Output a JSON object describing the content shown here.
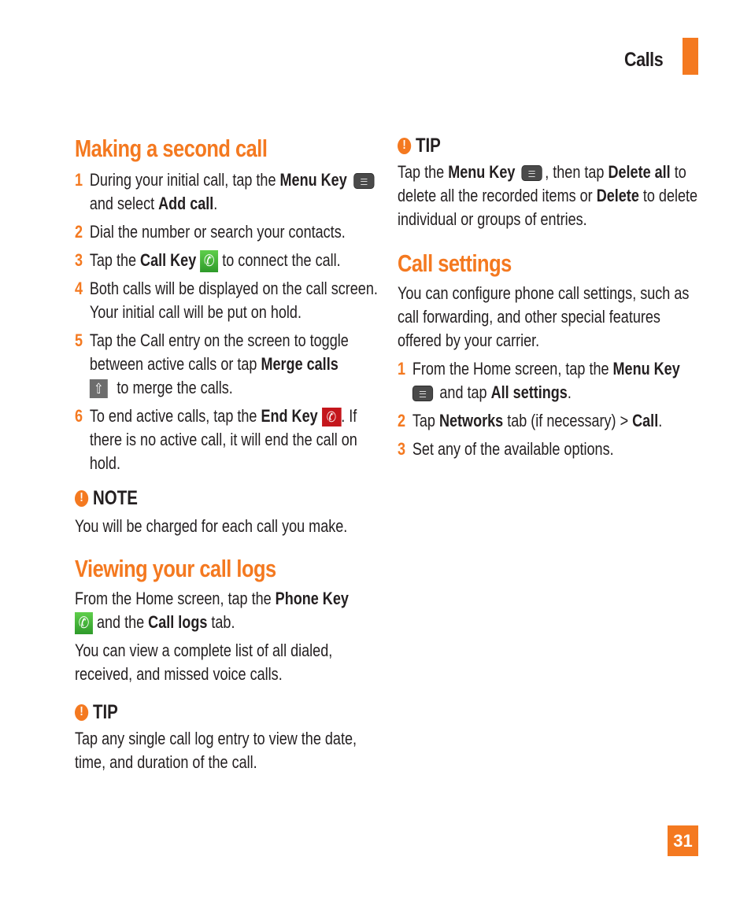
{
  "header": {
    "section": "Calls",
    "accent_color": "#f47920"
  },
  "page_number": "31",
  "making_second_call": {
    "title": "Making a second call",
    "steps": [
      {
        "num": "1",
        "t1": "During your initial call, tap the ",
        "b1": "Menu Key",
        "t2": " and select ",
        "b2": "Add call",
        "t3": "."
      },
      {
        "num": "2",
        "t1": "Dial the number or search your contacts."
      },
      {
        "num": "3",
        "t1": "Tap the ",
        "b1": "Call Key",
        "t2": " to connect the call."
      },
      {
        "num": "4",
        "t1": "Both calls will be displayed on the call screen. Your initial call will be put on hold."
      },
      {
        "num": "5",
        "t1": "Tap the Call entry on the screen to toggle between active calls or tap ",
        "b1": "Merge calls",
        "t2": " to merge the calls."
      },
      {
        "num": "6",
        "t1": "To end active calls, tap the ",
        "b1": "End Key",
        "t2": ". If there is no active call, it will end the call on hold."
      }
    ]
  },
  "note": {
    "label": "NOTE",
    "text": "You will be charged for each call you make."
  },
  "viewing_call_logs": {
    "title": "Viewing your call logs",
    "p1_t1": "From the Home screen, tap the ",
    "p1_b1": "Phone Key",
    "p1_t2": " and the ",
    "p1_b2": "Call logs",
    "p1_t3": " tab.",
    "p2": "You can view a complete list of all dialed, received, and missed voice calls."
  },
  "tip_left": {
    "label": "TIP",
    "text": "Tap any single call log entry to view the date, time, and duration of the call."
  },
  "tip_right": {
    "label": "TIP",
    "t1": "Tap the ",
    "b1": "Menu Key",
    "t2": ", then tap ",
    "b2": "Delete all",
    "t3": " to delete all the recorded items or ",
    "b3": "Delete",
    "t4": " to delete individual or groups of entries."
  },
  "call_settings": {
    "title": "Call settings",
    "intro": "You can configure phone call settings, such as call forwarding,  and other special features offered by your carrier.",
    "steps": [
      {
        "num": "1",
        "t1": "From the Home screen, tap the ",
        "b1": "Menu Key",
        "t2": " and tap ",
        "b2": "All settings",
        "t3": "."
      },
      {
        "num": "2",
        "t1": "Tap ",
        "b1": "Networks",
        "t2": " tab (if necessary) > ",
        "b2": "Call",
        "t3": "."
      },
      {
        "num": "3",
        "t1": "Set any of the available options."
      }
    ]
  },
  "icons": {
    "menu": "menu-key-icon",
    "call": "call-key-icon",
    "merge": "merge-calls-icon",
    "end": "end-key-icon",
    "alert": "exclamation-icon"
  }
}
